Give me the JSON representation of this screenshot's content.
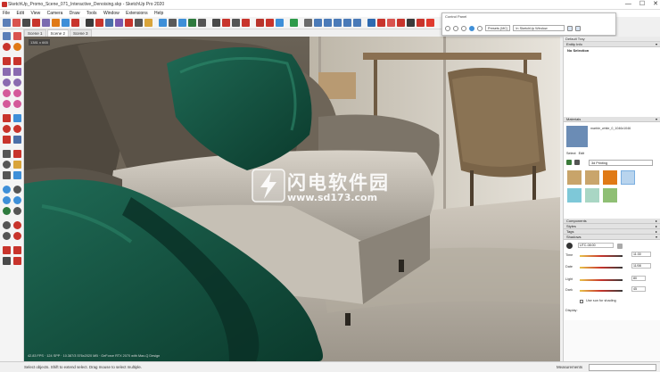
{
  "window": {
    "title": "SketchUp_Promo_Scene_071_Interactive_Denoising.skp - SketchUp Pro 2020",
    "min": "—",
    "max": "☐",
    "close": "✕"
  },
  "menu": [
    "File",
    "Edit",
    "View",
    "Camera",
    "Draw",
    "Tools",
    "Window",
    "Extensions",
    "Help"
  ],
  "scene_tabs": [
    "Scene 1",
    "Scene 2",
    "Scene 3"
  ],
  "control_panel": {
    "title": "Control Panel",
    "preset": "Presets (MC)",
    "target": "In SketchUp Window"
  },
  "viewport": {
    "badge": "1381 x 665",
    "stats": "42.83 FPS · 124 SPP · 10.387/3 576x2020 MB · GeForce RTX 2070 with Max-Q Design",
    "watermark_cn": "闪电软件园",
    "watermark_url": "www.sd173.com"
  },
  "tray": {
    "header": "Default Tray",
    "entity_info": "Entity Info",
    "no_selection": "No Selection",
    "materials": "Materials",
    "material_name": "marble_white_0_1046x1046",
    "mat_tabs": [
      "Select",
      "Edit"
    ],
    "mat_category": "3d Printing",
    "swatch_colors": [
      "#c8a46a",
      "#c9a56b",
      "#e07a16",
      "#b8d4ee",
      "#7ec8d8",
      "#a9d6c4",
      "#8fbf74"
    ],
    "components": "Components",
    "styles": "Styles",
    "tags": "Tags",
    "shadows": "Shadows",
    "utc": "UTC-08:00",
    "time_label": "Time",
    "time_val": "11:30",
    "date_label": "Date",
    "date_val": "11/08",
    "light_label": "Light",
    "light_val": "80",
    "dark_label": "Dark",
    "dark_val": "45",
    "use_sun": "Use sun for shading",
    "display": "Display:"
  },
  "status": {
    "message": "Select objects. Shift to extend select. Drag mouse to select multiple.",
    "measurements": "Measurements"
  }
}
